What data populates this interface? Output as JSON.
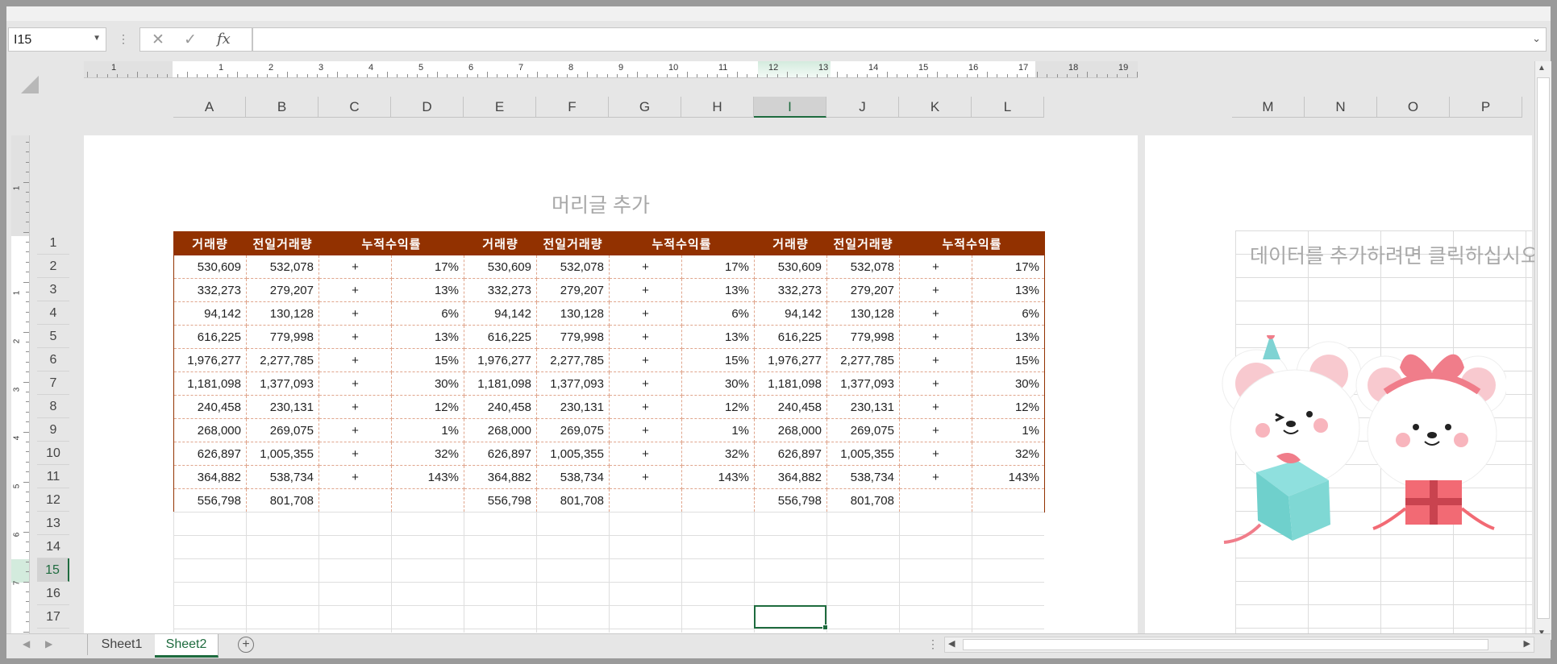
{
  "name_box": "I15",
  "formula_icons": {
    "cancel": "✕",
    "enter": "✓",
    "function": "fx"
  },
  "formula_value": "",
  "ruler_numbers": [
    "1",
    "1",
    "2",
    "3",
    "4",
    "5",
    "6",
    "7",
    "8",
    "9",
    "10",
    "11",
    "12",
    "13",
    "14",
    "15",
    "16",
    "17",
    "18",
    "19"
  ],
  "columns": [
    "A",
    "B",
    "C",
    "D",
    "E",
    "F",
    "G",
    "H",
    "I",
    "J",
    "K",
    "L"
  ],
  "right_columns": [
    "M",
    "N",
    "O",
    "P"
  ],
  "rows": [
    "1",
    "2",
    "3",
    "4",
    "5",
    "6",
    "7",
    "8",
    "9",
    "10",
    "11",
    "12",
    "13",
    "14",
    "15",
    "16",
    "17"
  ],
  "header_placeholder": "머리글 추가",
  "add_data_placeholder": "데이터를 추가하려면 클릭하십시오",
  "table": {
    "headers": [
      "거래량",
      "전일거래량",
      "누적수익률",
      "거래량",
      "전일거래량",
      "누적수익률",
      "거래량",
      "전일거래량",
      "누적수익률"
    ],
    "rows": [
      [
        "530,609",
        "532,078",
        "+",
        "17%"
      ],
      [
        "332,273",
        "279,207",
        "+",
        "13%"
      ],
      [
        "94,142",
        "130,128",
        "+",
        "6%"
      ],
      [
        "616,225",
        "779,998",
        "+",
        "13%"
      ],
      [
        "1,976,277",
        "2,277,785",
        "+",
        "15%"
      ],
      [
        "1,181,098",
        "1,377,093",
        "+",
        "30%"
      ],
      [
        "240,458",
        "230,131",
        "+",
        "12%"
      ],
      [
        "268,000",
        "269,075",
        "+",
        "1%"
      ],
      [
        "626,897",
        "1,005,355",
        "+",
        "32%"
      ],
      [
        "364,882",
        "538,734",
        "+",
        "143%"
      ],
      [
        "556,798",
        "801,708",
        "",
        ""
      ]
    ]
  },
  "sheets": [
    "Sheet1",
    "Sheet2"
  ],
  "active_sheet": "Sheet2",
  "colors": {
    "header_bg": "#923100",
    "accent": "#1e6b3e"
  }
}
